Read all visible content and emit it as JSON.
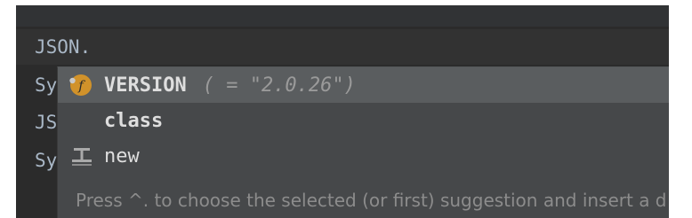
{
  "editor": {
    "lines": [
      "JSON.",
      "Sy",
      "JS",
      "Sy"
    ]
  },
  "completion": {
    "items": [
      {
        "name": "VERSION",
        "tail": "( = \"2.0.26\")",
        "icon": "field-icon"
      },
      {
        "name": "class",
        "tail": "",
        "icon": ""
      },
      {
        "name": "new",
        "tail": "",
        "icon": "constructor-icon"
      }
    ],
    "hint": "Press ^. to choose the selected (or first) suggestion and insert a d"
  },
  "colors": {
    "editor_bg": "#2b2b2b",
    "popup_bg": "#46484a",
    "selected_bg": "#5a5d5f",
    "code_text": "#a9b7c6",
    "field_icon": "#d1922a"
  }
}
